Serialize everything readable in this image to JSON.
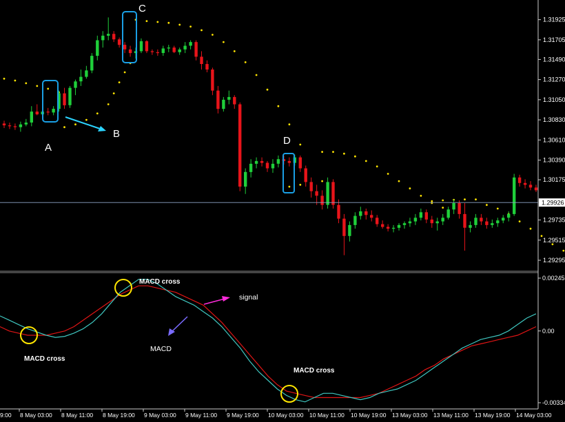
{
  "colors": {
    "background": "#000000",
    "bull": "#1fcf3a",
    "bear": "#e8141a",
    "sar": "#ffe400",
    "macd": "#3fc7c0",
    "signal": "#e01515",
    "highlight_box": "#1aa0e6",
    "circle": "#ffe600",
    "arrow_b": "#2bd4ff",
    "arrow_signal": "#ff2bdb",
    "arrow_macd": "#7a6bff",
    "price_line": "#8fa6c8"
  },
  "chart_data": [
    {
      "type": "candlestick",
      "price_axis": {
        "ticks": [
          "1.31925",
          "1.31705",
          "1.31490",
          "1.31270",
          "1.31050",
          "1.30830",
          "1.30610",
          "1.30390",
          "1.30175",
          "1.29735",
          "1.29515",
          "1.29295"
        ],
        "range": [
          1.2922,
          1.3208
        ]
      },
      "current_price": {
        "value": 1.29926,
        "label": "1.29926"
      },
      "time_axis": [
        "8 May 03:00",
        "8 May 11:00",
        "8 May 19:00",
        "9 May 03:00",
        "9 May 11:00",
        "9 May 19:00",
        "10 May 03:00",
        "10 May 11:00",
        "10 May 19:00",
        "13 May 03:00",
        "13 May 11:00",
        "13 May 19:00",
        "14 May 03:00"
      ],
      "time_axis_partial_left": "9:00",
      "candles": [
        [
          1.3079,
          1.3082,
          1.3074,
          1.3077
        ],
        [
          1.3077,
          1.308,
          1.3073,
          1.3076
        ],
        [
          1.3076,
          1.3079,
          1.3072,
          1.3075
        ],
        [
          1.3075,
          1.3081,
          1.307,
          1.3078
        ],
        [
          1.3078,
          1.3084,
          1.3076,
          1.308
        ],
        [
          1.308,
          1.3098,
          1.3076,
          1.3092
        ],
        [
          1.3092,
          1.31,
          1.3088,
          1.3089
        ],
        [
          1.3089,
          1.3095,
          1.3086,
          1.3092
        ],
        [
          1.3092,
          1.3096,
          1.3088,
          1.3091
        ],
        [
          1.3091,
          1.3098,
          1.3088,
          1.3095
        ],
        [
          1.3095,
          1.3115,
          1.3092,
          1.3112
        ],
        [
          1.3112,
          1.3118,
          1.3095,
          1.3099
        ],
        [
          1.3099,
          1.312,
          1.3096,
          1.3118
        ],
        [
          1.3118,
          1.3127,
          1.311,
          1.3125
        ],
        [
          1.3125,
          1.3138,
          1.312,
          1.313
        ],
        [
          1.313,
          1.3142,
          1.3128,
          1.3137
        ],
        [
          1.3137,
          1.3156,
          1.3134,
          1.3153
        ],
        [
          1.3153,
          1.3175,
          1.3148,
          1.317
        ],
        [
          1.317,
          1.318,
          1.3162,
          1.3175
        ],
        [
          1.3175,
          1.3195,
          1.317,
          1.3177
        ],
        [
          1.3177,
          1.318,
          1.3168,
          1.3171
        ],
        [
          1.3171,
          1.3173,
          1.3162,
          1.3165
        ],
        [
          1.3165,
          1.3168,
          1.3156,
          1.316
        ],
        [
          1.316,
          1.3164,
          1.3152,
          1.3156
        ],
        [
          1.3156,
          1.3162,
          1.315,
          1.3158
        ],
        [
          1.3158,
          1.3172,
          1.3156,
          1.3169
        ],
        [
          1.3169,
          1.317,
          1.3156,
          1.3158
        ],
        [
          1.3158,
          1.316,
          1.3154,
          1.3157
        ],
        [
          1.3157,
          1.316,
          1.3153,
          1.3156
        ],
        [
          1.3156,
          1.3164,
          1.3153,
          1.3161
        ],
        [
          1.3161,
          1.3165,
          1.3157,
          1.3162
        ],
        [
          1.3162,
          1.3164,
          1.3156,
          1.3157
        ],
        [
          1.3157,
          1.3162,
          1.3154,
          1.316
        ],
        [
          1.316,
          1.3168,
          1.3156,
          1.3164
        ],
        [
          1.3164,
          1.317,
          1.316,
          1.3168
        ],
        [
          1.3168,
          1.317,
          1.3148,
          1.3152
        ],
        [
          1.3152,
          1.3158,
          1.3138,
          1.3144
        ],
        [
          1.3144,
          1.3148,
          1.3135,
          1.3138
        ],
        [
          1.3138,
          1.314,
          1.311,
          1.3115
        ],
        [
          1.3115,
          1.312,
          1.309,
          1.3095
        ],
        [
          1.3095,
          1.3108,
          1.3092,
          1.3105
        ],
        [
          1.3105,
          1.3115,
          1.31,
          1.3108
        ],
        [
          1.3108,
          1.311,
          1.3095,
          1.31
        ],
        [
          1.31,
          1.3102,
          1.3005,
          1.301
        ],
        [
          1.301,
          1.303,
          1.3002,
          1.3026
        ],
        [
          1.3026,
          1.304,
          1.302,
          1.3035
        ],
        [
          1.3035,
          1.3042,
          1.303,
          1.3038
        ],
        [
          1.3038,
          1.3042,
          1.3032,
          1.3036
        ],
        [
          1.3036,
          1.3038,
          1.3026,
          1.303
        ],
        [
          1.303,
          1.304,
          1.3025,
          1.3035
        ],
        [
          1.3035,
          1.3044,
          1.3031,
          1.304
        ],
        [
          1.304,
          1.3044,
          1.3034,
          1.3038
        ],
        [
          1.3038,
          1.3042,
          1.3032,
          1.3036
        ],
        [
          1.3036,
          1.3045,
          1.3033,
          1.3042
        ],
        [
          1.3042,
          1.3044,
          1.3026,
          1.303
        ],
        [
          1.303,
          1.3033,
          1.301,
          1.3015
        ],
        [
          1.3015,
          1.302,
          1.2998,
          1.3005
        ],
        [
          1.3005,
          1.3012,
          1.299,
          1.3
        ],
        [
          1.3,
          1.3006,
          1.2985,
          1.299
        ],
        [
          1.299,
          1.302,
          1.2986,
          1.3015
        ],
        [
          1.3015,
          1.3018,
          1.2986,
          1.299
        ],
        [
          1.299,
          1.2996,
          1.297,
          1.2975
        ],
        [
          1.2975,
          1.298,
          1.2935,
          1.2956
        ],
        [
          1.2956,
          1.2972,
          1.295,
          1.2968
        ],
        [
          1.2968,
          1.2982,
          1.2964,
          1.2978
        ],
        [
          1.2978,
          1.2988,
          1.2974,
          1.2983
        ],
        [
          1.2983,
          1.2986,
          1.2974,
          1.2979
        ],
        [
          1.2979,
          1.2984,
          1.2972,
          1.2976
        ],
        [
          1.2976,
          1.2979,
          1.2966,
          1.2969
        ],
        [
          1.2969,
          1.2973,
          1.2964,
          1.2966
        ],
        [
          1.2966,
          1.2969,
          1.2961,
          1.2964
        ],
        [
          1.2964,
          1.2968,
          1.296,
          1.2965
        ],
        [
          1.2965,
          1.297,
          1.2962,
          1.2968
        ],
        [
          1.2968,
          1.2972,
          1.2964,
          1.297
        ],
        [
          1.297,
          1.2976,
          1.2966,
          1.2972
        ],
        [
          1.2972,
          1.298,
          1.2968,
          1.2976
        ],
        [
          1.2976,
          1.2986,
          1.2973,
          1.2982
        ],
        [
          1.2982,
          1.2985,
          1.297,
          1.2974
        ],
        [
          1.2974,
          1.2978,
          1.2965,
          1.297
        ],
        [
          1.297,
          1.2976,
          1.2962,
          1.2972
        ],
        [
          1.2972,
          1.298,
          1.2968,
          1.2976
        ],
        [
          1.2976,
          1.2988,
          1.2974,
          1.2985
        ],
        [
          1.2985,
          1.2996,
          1.298,
          1.2992
        ],
        [
          1.2992,
          1.2995,
          1.2975,
          1.298
        ],
        [
          1.298,
          1.2992,
          1.294,
          1.2965
        ],
        [
          1.2965,
          1.2972,
          1.296,
          1.2968
        ],
        [
          1.2968,
          1.298,
          1.2965,
          1.2976
        ],
        [
          1.2976,
          1.298,
          1.2968,
          1.2972
        ],
        [
          1.2972,
          1.2976,
          1.2964,
          1.2968
        ],
        [
          1.2968,
          1.2974,
          1.2965,
          1.297
        ],
        [
          1.297,
          1.2976,
          1.2966,
          1.2973
        ],
        [
          1.2973,
          1.2979,
          1.297,
          1.2976
        ],
        [
          1.2976,
          1.2983,
          1.2972,
          1.298
        ],
        [
          1.298,
          1.3024,
          1.2978,
          1.302
        ],
        [
          1.302,
          1.3023,
          1.301,
          1.3014
        ],
        [
          1.3014,
          1.3018,
          1.3008,
          1.3012
        ],
        [
          1.3012,
          1.3016,
          1.3006,
          1.3009
        ],
        [
          1.3009,
          1.3012,
          1.3004,
          1.3006
        ]
      ],
      "sar": [
        [
          0,
          1.3128
        ],
        [
          2,
          1.3126
        ],
        [
          4,
          1.3123
        ],
        [
          6,
          1.312
        ],
        [
          8,
          1.3117
        ],
        [
          10,
          1.3113
        ],
        [
          11,
          1.3107
        ],
        [
          11,
          1.3075
        ],
        [
          13,
          1.3078
        ],
        [
          15,
          1.3083
        ],
        [
          17,
          1.309
        ],
        [
          19,
          1.31
        ],
        [
          20,
          1.3112
        ],
        [
          21,
          1.3124
        ],
        [
          22,
          1.3135
        ],
        [
          23,
          1.3145
        ],
        [
          24,
          1.31925
        ],
        [
          26,
          1.3191
        ],
        [
          28,
          1.319
        ],
        [
          30,
          1.3189
        ],
        [
          32,
          1.3187
        ],
        [
          34,
          1.3185
        ],
        [
          36,
          1.3181
        ],
        [
          38,
          1.3176
        ],
        [
          40,
          1.3168
        ],
        [
          42,
          1.3158
        ],
        [
          44,
          1.3146
        ],
        [
          46,
          1.3132
        ],
        [
          48,
          1.3116
        ],
        [
          50,
          1.3098
        ],
        [
          52,
          1.3078
        ],
        [
          54,
          1.3056
        ],
        [
          52,
          1.301
        ],
        [
          54,
          1.3012
        ],
        [
          56,
          1.3014
        ],
        [
          58,
          1.3016
        ],
        [
          58,
          1.3048
        ],
        [
          60,
          1.3048
        ],
        [
          62,
          1.3046
        ],
        [
          64,
          1.3043
        ],
        [
          66,
          1.3038
        ],
        [
          68,
          1.3032
        ],
        [
          70,
          1.3024
        ],
        [
          72,
          1.3016
        ],
        [
          74,
          1.3008
        ],
        [
          76,
          1.3
        ],
        [
          78,
          1.2992
        ],
        [
          80,
          1.2987
        ],
        [
          78,
          1.2994
        ],
        [
          80,
          1.2995
        ],
        [
          82,
          1.29955
        ],
        [
          84,
          1.2996
        ],
        [
          86,
          1.2996
        ],
        [
          88,
          1.299
        ],
        [
          90,
          1.2986
        ],
        [
          92,
          1.298
        ],
        [
          94,
          1.2972
        ],
        [
          96,
          1.2964
        ],
        [
          98,
          1.2956
        ],
        [
          100,
          1.2947
        ],
        [
          102,
          1.294
        ],
        [
          104,
          1.2936
        ],
        [
          104,
          1.2942
        ],
        [
          106,
          1.2944
        ],
        [
          108,
          1.2946
        ],
        [
          110,
          1.2948
        ],
        [
          112,
          1.295
        ],
        [
          114,
          1.2952
        ],
        [
          116,
          1.2955
        ],
        [
          118,
          1.2958
        ],
        [
          120,
          1.2962
        ]
      ],
      "annotations": {
        "A": "A",
        "B": "B",
        "C": "C",
        "D": "D"
      }
    },
    {
      "type": "line",
      "indicator": "MACD",
      "value_axis": {
        "ticks": [
          "0.002459",
          "0.00",
          "-0.00334"
        ],
        "range": [
          -0.00334,
          0.002459
        ]
      },
      "series": [
        {
          "role": "macd",
          "values": [
            0.0007,
            0.0005,
            0.0003,
            0.0001,
            -5e-05,
            -0.0002,
            -0.0003,
            -0.00025,
            -0.0001,
            0.0001,
            0.0004,
            0.0008,
            0.0013,
            0.0018,
            0.0021,
            0.0024,
            0.0024,
            0.0022,
            0.0019,
            0.0016,
            0.0014,
            0.0012,
            0.0009,
            0.0006,
            0.0002,
            -0.0003,
            -0.0008,
            -0.0014,
            -0.0019,
            -0.0023,
            -0.0027,
            -0.003,
            -0.0032,
            -0.0033,
            -0.0031,
            -0.0029,
            -0.0029,
            -0.003,
            -0.0031,
            -0.0032,
            -0.0031,
            -0.0029,
            -0.0028,
            -0.0027,
            -0.0025,
            -0.0023,
            -0.002,
            -0.0017,
            -0.0014,
            -0.0011,
            -0.0008,
            -0.0006,
            -0.0004,
            -0.0003,
            -0.0002,
            0.0,
            0.0003,
            0.0006,
            0.0008
          ]
        },
        {
          "role": "signal",
          "values": [
            0.0002,
            0.0,
            -0.0001,
            -0.0002,
            -0.0002,
            -0.0002,
            -0.0001,
            0.0,
            0.0002,
            0.0005,
            0.0008,
            0.0011,
            0.0014,
            0.0017,
            0.0019,
            0.0021,
            0.0021,
            0.002,
            0.0019,
            0.0018,
            0.0016,
            0.0014,
            0.0012,
            0.0008,
            0.0004,
            -0.0001,
            -0.0006,
            -0.0011,
            -0.0016,
            -0.0021,
            -0.0025,
            -0.0028,
            -0.0029,
            -0.003,
            -0.0031,
            -0.0031,
            -0.0031,
            -0.0031,
            -0.0031,
            -0.0031,
            -0.003,
            -0.0029,
            -0.0027,
            -0.0025,
            -0.0023,
            -0.0021,
            -0.0018,
            -0.0016,
            -0.0013,
            -0.0011,
            -0.0009,
            -0.0007,
            -0.0006,
            -0.0005,
            -0.0004,
            -0.0003,
            -0.0002,
            0.0,
            0.0002
          ]
        }
      ],
      "annotations": {
        "cross1": "MACD cross",
        "cross2": "MACD cross",
        "cross3": "MACD cross",
        "signal_label": "signal",
        "macd_label": "MACD"
      }
    }
  ]
}
